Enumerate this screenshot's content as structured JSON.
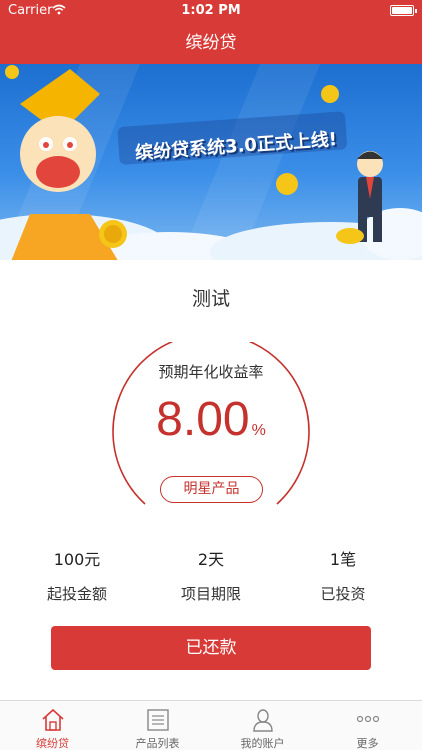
{
  "status_bar": {
    "carrier": "Carrier",
    "time": "1:02 PM"
  },
  "nav": {
    "title": "缤纷贷"
  },
  "banner": {
    "headline": "缤纷贷系统3.0正式上线!"
  },
  "product": {
    "name": "测试",
    "rate_label": "预期年化收益率",
    "rate_value": "8.00",
    "rate_unit": "%",
    "badge": "明星产品",
    "stats": [
      {
        "value": "100元",
        "label": "起投金额"
      },
      {
        "value": "2天",
        "label": "项目期限"
      },
      {
        "value": "1笔",
        "label": "已投资"
      }
    ],
    "action_label": "已还款"
  },
  "tabs": [
    {
      "label": "缤纷贷",
      "icon": "home-icon",
      "active": true
    },
    {
      "label": "产品列表",
      "icon": "list-icon",
      "active": false
    },
    {
      "label": "我的账户",
      "icon": "user-icon",
      "active": false
    },
    {
      "label": "更多",
      "icon": "more-icon",
      "active": false
    }
  ],
  "colors": {
    "brand": "#d83b37",
    "accent_text": "#c5312c"
  }
}
